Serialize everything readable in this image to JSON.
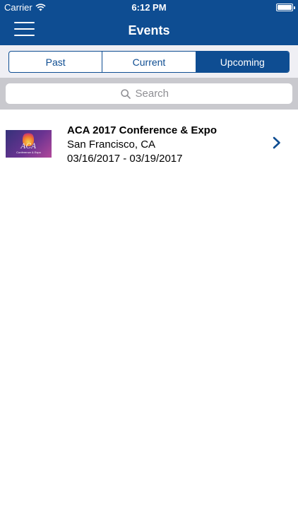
{
  "status_bar": {
    "carrier": "Carrier",
    "time": "6:12 PM",
    "battery_level": 1.0
  },
  "nav": {
    "title": "Events",
    "menu_icon": "hamburger-menu-icon"
  },
  "segments": [
    {
      "label": "Past",
      "selected": false
    },
    {
      "label": "Current",
      "selected": false
    },
    {
      "label": "Upcoming",
      "selected": true
    }
  ],
  "search": {
    "placeholder": "Search",
    "icon": "search-icon"
  },
  "events": [
    {
      "title": "ACA 2017 Conference & Expo",
      "location": "San Francisco, CA",
      "dates": "03/16/2017 - 03/19/2017",
      "thumbnail_text": "ACA",
      "thumbnail_subtext": "Conference & Expo"
    }
  ],
  "colors": {
    "brand": "#0e4d92",
    "background": "#ffffff",
    "search_bar": "#c9c9ce",
    "segment_bg": "#efeff4"
  }
}
